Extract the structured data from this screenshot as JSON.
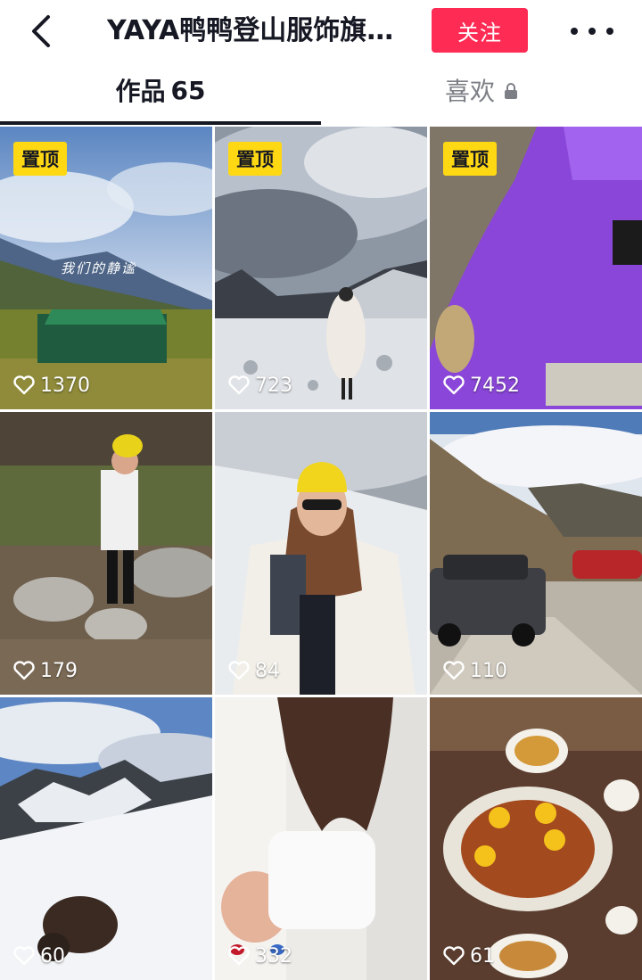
{
  "header": {
    "title": "YAYA鸭鸭登山服饰旗…",
    "follow_label": "关注",
    "back_icon": "back-arrow-icon",
    "more_icon": "more-icon"
  },
  "tabs": [
    {
      "label": "作品",
      "count": "65",
      "active": true
    },
    {
      "label": "喜欢",
      "locked": true,
      "active": false
    }
  ],
  "colors": {
    "follow": "#fe2c55",
    "pin": "#ffd814",
    "text": "#161823",
    "inactive_tab": "#7d7f86"
  },
  "videos": [
    {
      "pinned": "置顶",
      "likes": "1370",
      "caption": "我们的静谧"
    },
    {
      "pinned": "置顶",
      "likes": "723"
    },
    {
      "pinned": "置顶",
      "likes": "7452"
    },
    {
      "likes": "179"
    },
    {
      "likes": "84"
    },
    {
      "likes": "110"
    },
    {
      "likes": "60"
    },
    {
      "likes": "332"
    },
    {
      "likes": "61"
    }
  ]
}
